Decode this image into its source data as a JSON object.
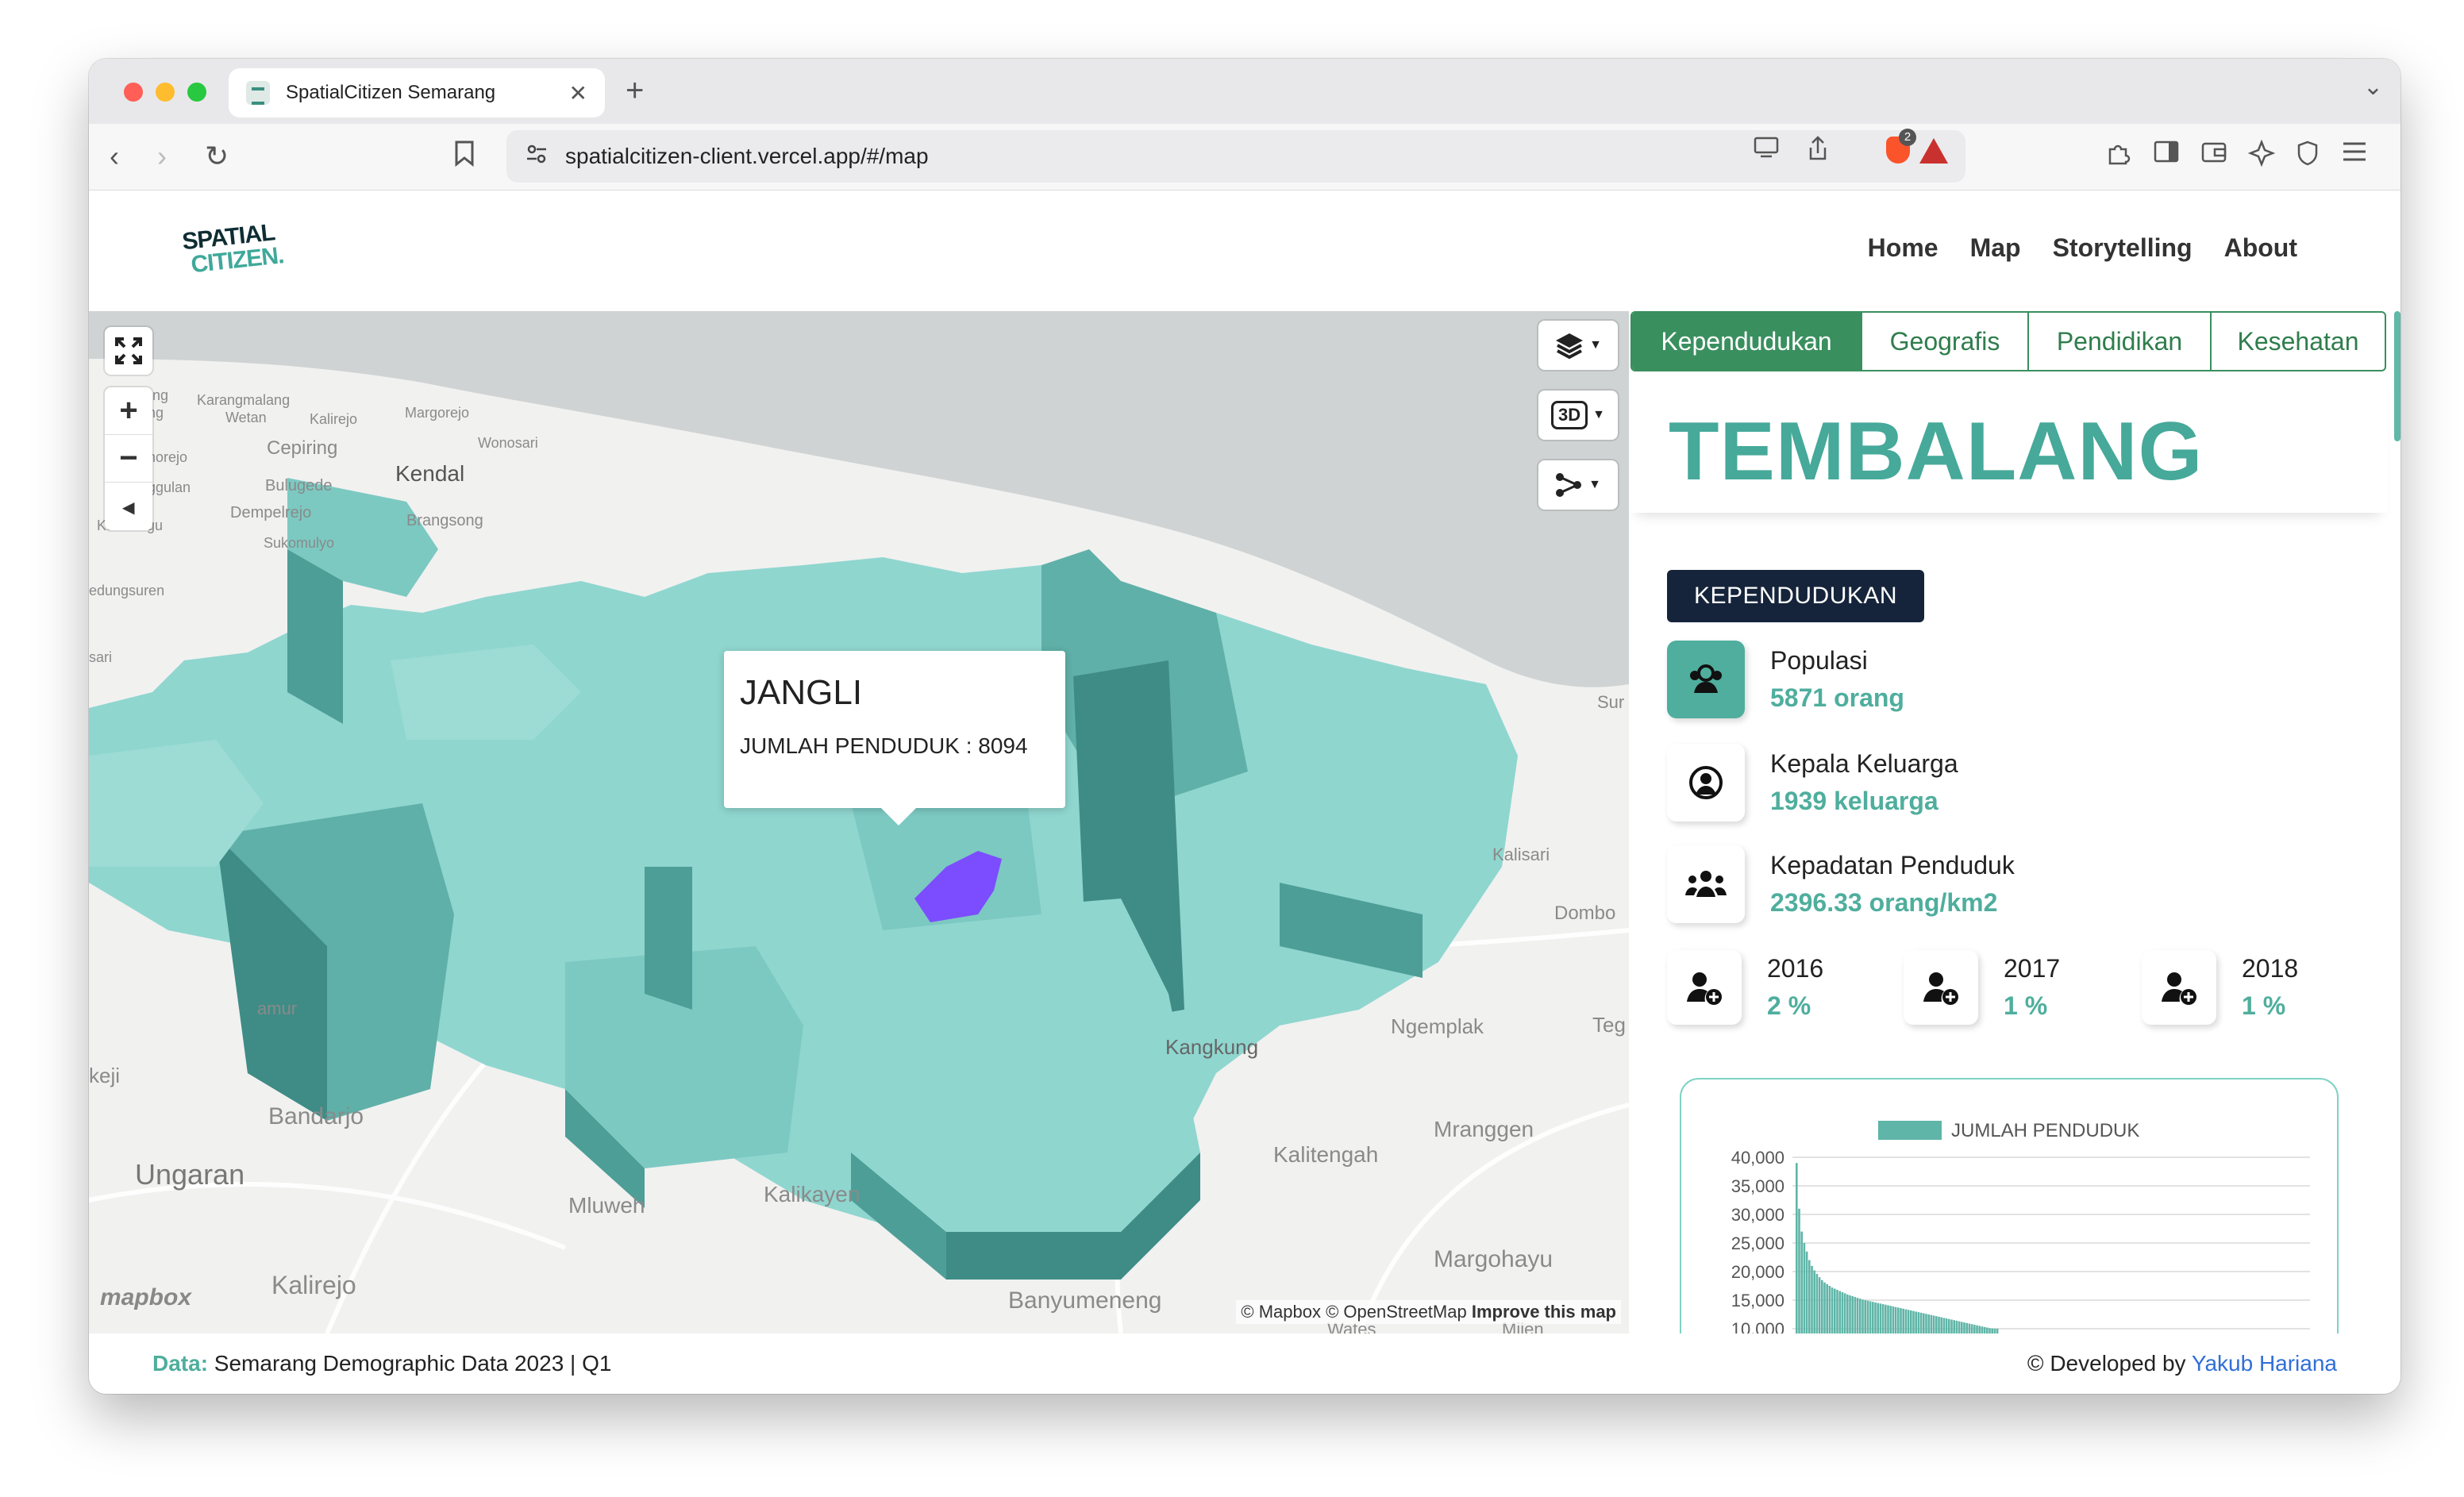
{
  "browser": {
    "tab_title": "SpatialCitizen Semarang",
    "tab_close": "✕",
    "new_tab": "+",
    "tab_menu": "⌄",
    "back": "‹",
    "forward": "›",
    "reload": "↻",
    "url": "spatialcitizen-client.vercel.app/#/map",
    "shield_badge": "2"
  },
  "header": {
    "logo_line1": "SPATIAL",
    "logo_line2": "CITIZEN.",
    "nav": [
      "Home",
      "Map",
      "Storytelling",
      "About"
    ]
  },
  "map": {
    "zoom_in": "+",
    "zoom_out": "−",
    "compass": "◂",
    "btn_3d": "3D",
    "popup": {
      "title": "JANGLI",
      "body": "JUMLAH PENDUDUK : 8094"
    },
    "place_labels": [
      "Karangmalang",
      "Wetan",
      "Kalirejo",
      "Margorejo",
      "Wonosari",
      "Cepiring",
      "Kendal",
      "Bulugede",
      "Dempelrejo",
      "Brangsong",
      "Sukomulyo",
      "Kaliwungu",
      "edungsuren",
      "sari",
      "Sur",
      "Kalisari",
      "Dombo",
      "Ngemplak",
      "Teg",
      "Kangkung",
      "Mranggen",
      "Kalitengah",
      "Bandarjo",
      "Ungaran",
      "Mluweh",
      "Kalikayen",
      "Kalirejo",
      "Margohayu",
      "Banyumeneng",
      "keji",
      "amur",
      "nggulan",
      "horejo",
      "ang",
      "ing",
      "Mijen",
      "Wates"
    ],
    "mapbox_logo": "mapbox",
    "attribution": "© Mapbox © OpenStreetMap",
    "attribution_improve": "Improve this map",
    "colors": {
      "water": "#cfd3d3",
      "land": "#f1f1f0",
      "extrusion_top": "#8fd6cf",
      "extrusion_side": "#4d9e97",
      "highlight": "#7c4dff"
    }
  },
  "panel": {
    "tabs": [
      "Kependudukan",
      "Geografis",
      "Pendidikan",
      "Kesehatan"
    ],
    "area_title": "TEMBALANG",
    "section_badge": "KEPENDUDUKAN",
    "stats": {
      "populasi_label": "Populasi",
      "populasi_value": "5871 orang",
      "kk_label": "Kepala Keluarga",
      "kk_value": "1939 keluarga",
      "kepadatan_label": "Kepadatan Penduduk",
      "kepadatan_value": "2396.33 orang/km2"
    },
    "growth": [
      {
        "year": "2016",
        "value": "2 %"
      },
      {
        "year": "2017",
        "value": "1 %"
      },
      {
        "year": "2018",
        "value": "1 %"
      }
    ],
    "accent": "#4fae9d"
  },
  "chart_data": {
    "type": "bar",
    "legend": [
      "JUMLAH PENDUDUK"
    ],
    "ylim": [
      10000,
      40000
    ],
    "yticks": [
      "40,000",
      "35,000",
      "30,000",
      "25,000",
      "20,000",
      "15,000",
      "10,000"
    ],
    "series": [
      {
        "name": "JUMLAH PENDUDUK",
        "values": [
          39000,
          31000,
          27000,
          25000,
          23500,
          22000,
          21000,
          20200,
          19600,
          19000,
          18500,
          18100,
          17800,
          17500,
          17200,
          17000,
          16800,
          16600,
          16400,
          16200,
          16000,
          15850,
          15700,
          15550,
          15400,
          15250,
          15100,
          15000,
          14900,
          14800,
          14700,
          14600,
          14500,
          14400,
          14300,
          14200,
          14100,
          14000,
          13900,
          13800,
          13700,
          13600,
          13500,
          13400,
          13300,
          13200,
          13100,
          13000,
          12900,
          12800,
          12700,
          12600,
          12500,
          12400,
          12300,
          12200,
          12100,
          12000,
          11900,
          11800,
          11700,
          11600,
          11500,
          11400,
          11300,
          11200,
          11100,
          11000,
          10900,
          10800,
          10700,
          10600,
          10500,
          10400,
          10300,
          10200,
          10100,
          10050,
          10020,
          10010
        ]
      }
    ]
  },
  "footer": {
    "label": "Data:",
    "text": " Semarang Demographic Data 2023 | Q1",
    "dev_prefix": "© Developed by ",
    "author": "Yakub Hariana"
  }
}
